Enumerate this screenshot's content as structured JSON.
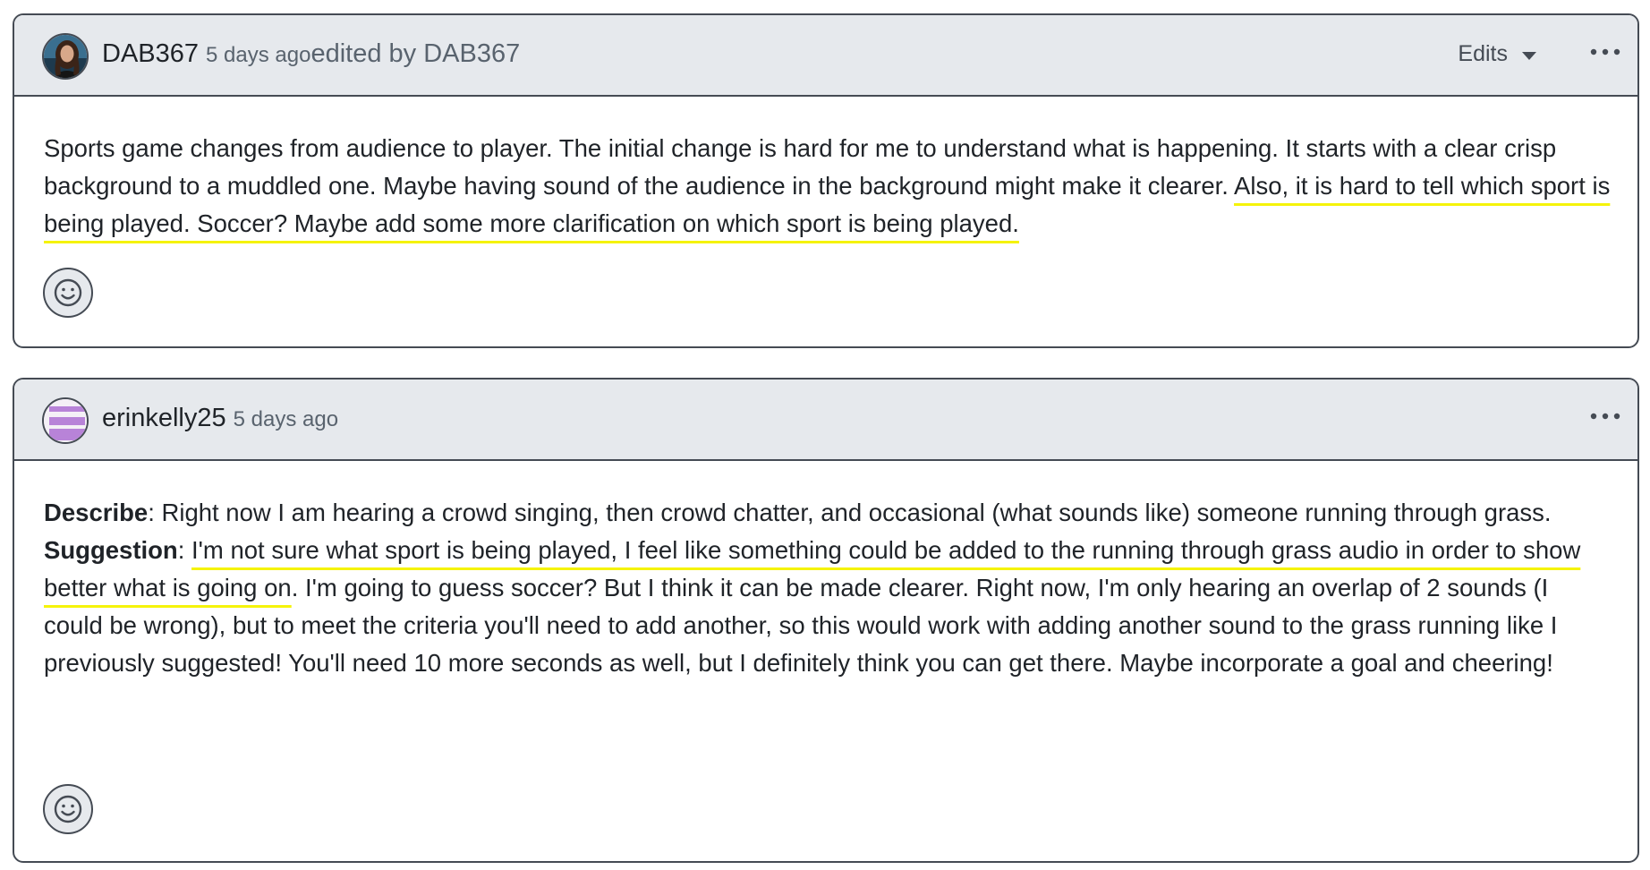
{
  "comments": [
    {
      "author": "DAB367",
      "timestamp": "5 days ago",
      "edited_text": "edited by DAB367",
      "edits_label": "Edits",
      "body": {
        "part1": "Sports game changes from audience to player. The initial change is hard for me to understand what is happening. It starts with a clear crisp background to a muddled one. Maybe having sound of the audience in the background might make it clearer. ",
        "highlight": "Also, it is hard to tell which sport is being played. Soccer? Maybe add some more clarification on which sport is being played."
      }
    },
    {
      "author": "erinkelly25",
      "timestamp": "5 days ago",
      "body": {
        "describe_label": "Describe",
        "describe_text": ": Right now I am hearing a crowd singing, then crowd chatter, and occasional (what sounds like) someone running through grass.",
        "suggestion_label": "Suggestion",
        "suggestion_sep": ": ",
        "highlight": "I'm not sure what sport is being played, I feel like something could be added to the running through grass audio in order to show better what is going on",
        "rest": ". I'm going to guess soccer? But I think it can be made clearer. Right now, I'm only hearing an overlap of 2 sounds (I could be wrong), but to meet the criteria you'll need to add another, so this would work with adding another sound to the grass running like I previously suggested! You'll need 10 more seconds as well, but I definitely think you can get there. Maybe incorporate a goal and cheering!"
      }
    }
  ],
  "icons": {
    "more": "kebab-horizontal-icon",
    "reaction": "smiley-icon",
    "dropdown": "triangle-down-icon"
  },
  "colors": {
    "header_bg": "#e6e9ed",
    "border": "#454b54",
    "highlight_underline": "#f5f30a",
    "avatar2_accent": "#b883d8"
  }
}
